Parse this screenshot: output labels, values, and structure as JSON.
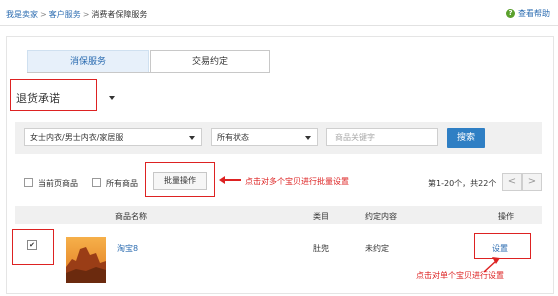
{
  "breadcrumb": {
    "items": [
      "我是卖家",
      "客户服务",
      "消费者保障服务"
    ],
    "separator": ">"
  },
  "help": {
    "icon": "help-icon",
    "label": "查看帮助"
  },
  "tabs": [
    {
      "label": "消保服务",
      "active": false
    },
    {
      "label": "交易约定",
      "active": true
    }
  ],
  "promise_dropdown": {
    "value": "退货承诺",
    "icon": "chevron-down-icon"
  },
  "filters": {
    "category": {
      "value": "女士内衣/男士内衣/家居服"
    },
    "status": {
      "value": "所有状态"
    },
    "keyword": {
      "placeholder": "商品关键字"
    },
    "search_label": "搜索"
  },
  "bulk": {
    "current_page_label": "当前页商品",
    "all_label": "所有商品",
    "batch_button_label": "批量操作",
    "annotation": "点击对多个宝贝进行批量设置"
  },
  "pagination": {
    "info": "第1-20个，共22个",
    "prev": "<",
    "next": ">"
  },
  "table": {
    "headers": {
      "name": "商品名称",
      "category": "类目",
      "promise": "约定内容",
      "action": "操作"
    },
    "rows": [
      {
        "checked": true,
        "name": "淘宝8",
        "category": "肚兜",
        "promise": "未约定",
        "action": "设置"
      }
    ]
  },
  "row_annotation": "点击对单个宝贝进行设置",
  "colors": {
    "accent": "#2f7fc4",
    "link": "#2a6bb0",
    "annotation": "#dd2222",
    "help_green": "#5aa02c"
  }
}
